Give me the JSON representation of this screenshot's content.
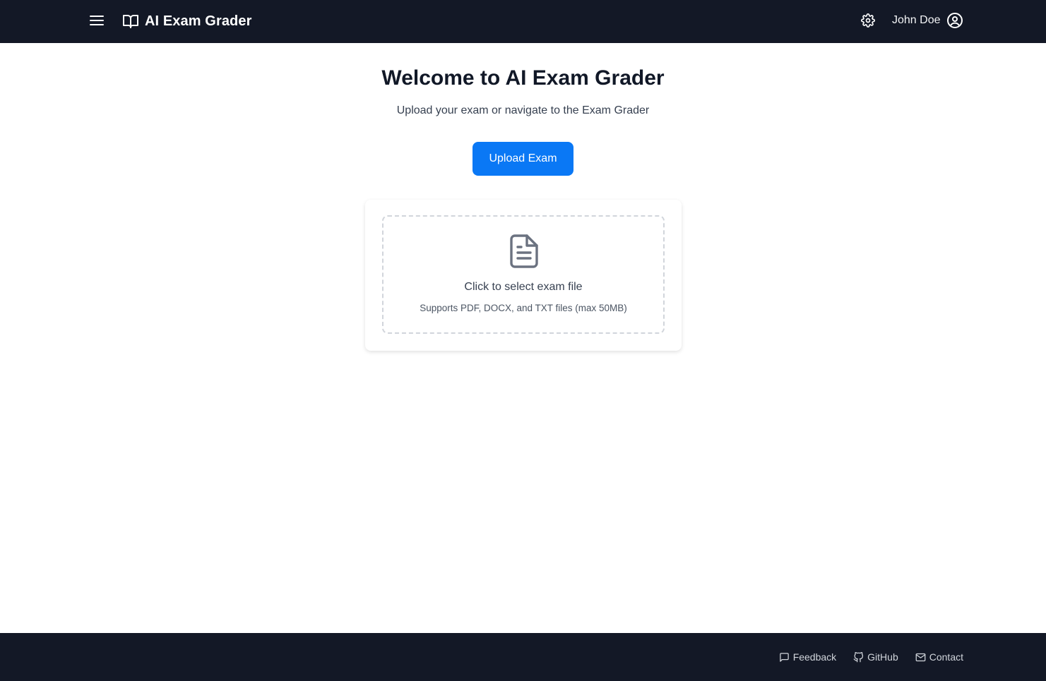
{
  "header": {
    "app_title": "AI Exam Grader",
    "user_name": "John Doe",
    "icons": {
      "menu": "menu-icon",
      "brand": "book-open-icon",
      "settings": "gear-icon",
      "user": "user-circle-icon"
    }
  },
  "main": {
    "title": "Welcome to AI Exam Grader",
    "subtitle": "Upload your exam or navigate to the Exam Grader",
    "upload_button_label": "Upload Exam",
    "dropzone": {
      "icon": "file-text-icon",
      "label": "Click to select exam file",
      "hint": "Supports PDF, DOCX, and TXT files (max 50MB)"
    }
  },
  "footer": {
    "links": [
      {
        "label": "Feedback",
        "icon": "message-square-icon"
      },
      {
        "label": "GitHub",
        "icon": "github-icon"
      },
      {
        "label": "Contact",
        "icon": "mail-icon"
      }
    ]
  },
  "colors": {
    "header_bg": "#131826",
    "accent": "#0a78f5",
    "page_bg": "#ffffff"
  }
}
